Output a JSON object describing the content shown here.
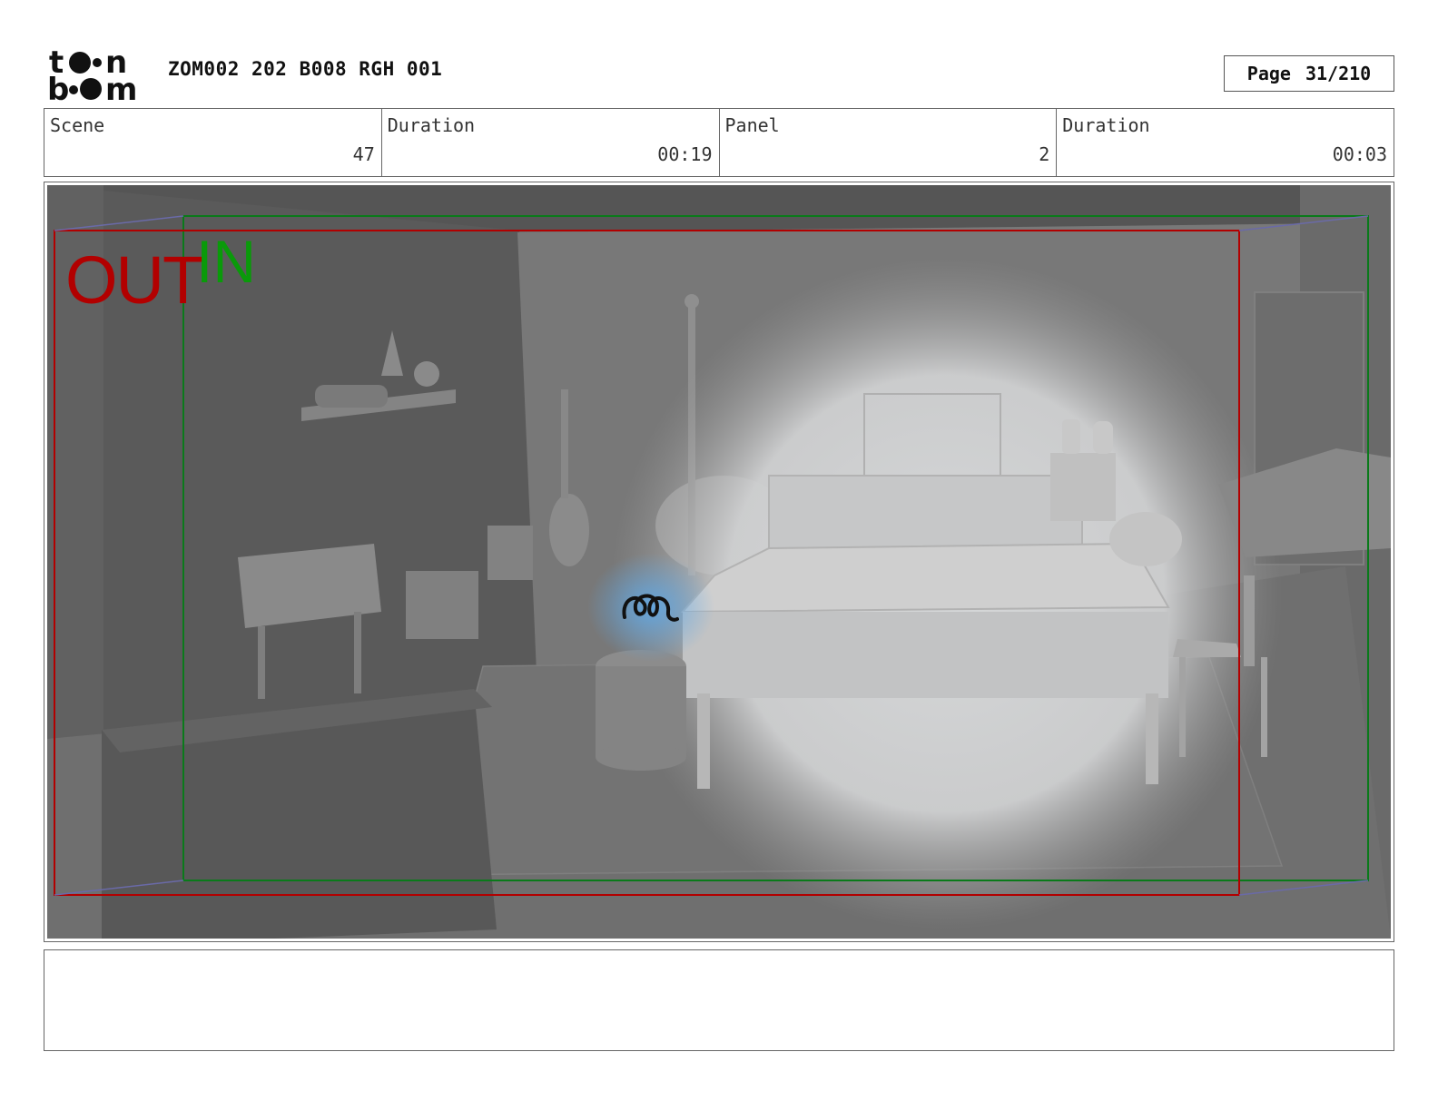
{
  "header": {
    "logo_text_top": "toon",
    "logo_text_bottom": "boom",
    "title": "ZOM002 202 B008 RGH 001",
    "page_label": "Page",
    "page_value": "31/210"
  },
  "info": [
    {
      "label": "Scene",
      "value": "47"
    },
    {
      "label": "Duration",
      "value": "00:19"
    },
    {
      "label": "Panel",
      "value": "2"
    },
    {
      "label": "Duration",
      "value": "00:03"
    }
  ],
  "panel": {
    "out_label": "OUT",
    "in_label": "IN",
    "out_frame_color": "#b20000",
    "in_frame_color": "#0a7a1a"
  },
  "notes": {
    "text": ""
  }
}
